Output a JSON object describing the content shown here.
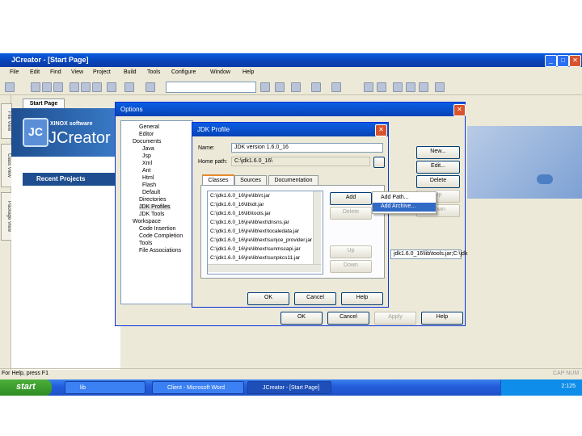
{
  "window": {
    "title": "JCreator - [Start Page]",
    "menu": [
      "File",
      "Edit",
      "Find",
      "View",
      "Project",
      "Build",
      "Tools",
      "Configure",
      "Window",
      "Help"
    ],
    "side_tabs": [
      "File View",
      "Class View",
      "Package View"
    ],
    "doc_tab": "Start Page",
    "start_page": {
      "logo": "JC",
      "brand_sub": "XINOX software",
      "brand": "JCreator",
      "recent_projects": "Recent Projects"
    },
    "status_left": "For Help, press F1",
    "status_right": "CAP NUM"
  },
  "taskbar": {
    "start": "start",
    "tasks": [
      "lib",
      "Client - Microsoft Word",
      "JCreator - [Start Page]"
    ],
    "clock": "2:125"
  },
  "options_dialog": {
    "title": "Options",
    "tree": [
      "General",
      "Editor",
      "Documents",
      "Java",
      "Jsp",
      "Xml",
      "Ant",
      "Html",
      "Flash",
      "Default",
      "Directories",
      "JDK Profiles",
      "JDK Tools",
      "Workspace",
      "Code Insertion",
      "Code Completion",
      "Tools",
      "File Associations"
    ],
    "buttons": {
      "new": "New...",
      "edit": "Edit...",
      "delete": "Delete",
      "up": "Up",
      "down": "Down",
      "ok": "OK",
      "cancel": "Cancel",
      "apply": "Apply",
      "help": "Help"
    },
    "path_value": "jdk1.6.0_16\\lib\\tools.jar;C:\\jdk"
  },
  "jdk_profile": {
    "title": "JDK Profile",
    "name_label": "Name:",
    "name_value": "JDK version 1.6.0_16",
    "home_label": "Home path:",
    "home_value": "C:\\jdk1.6.0_16\\",
    "tabs": [
      "Classes",
      "Sources",
      "Documentation"
    ],
    "classes": [
      "C:\\jdk1.6.0_16\\jre\\lib\\rt.jar",
      "C:\\jdk1.6.0_16\\lib\\dt.jar",
      "C:\\jdk1.6.0_16\\lib\\tools.jar",
      "C:\\jdk1.6.0_16\\jre\\lib\\ext\\dnsns.jar",
      "C:\\jdk1.6.0_16\\jre\\lib\\ext\\localedata.jar",
      "C:\\jdk1.6.0_16\\jre\\lib\\ext\\sunjce_provider.jar",
      "C:\\jdk1.6.0_16\\jre\\lib\\ext\\sunmscapi.jar",
      "C:\\jdk1.6.0_16\\jre\\lib\\ext\\sunpkcs11.jar"
    ],
    "buttons": {
      "add": "Add",
      "delete": "Delete",
      "up": "Up",
      "down": "Down",
      "ok": "OK",
      "cancel": "Cancel",
      "help": "Help"
    },
    "add_menu": [
      "Add Path...",
      "Add Archive..."
    ]
  }
}
